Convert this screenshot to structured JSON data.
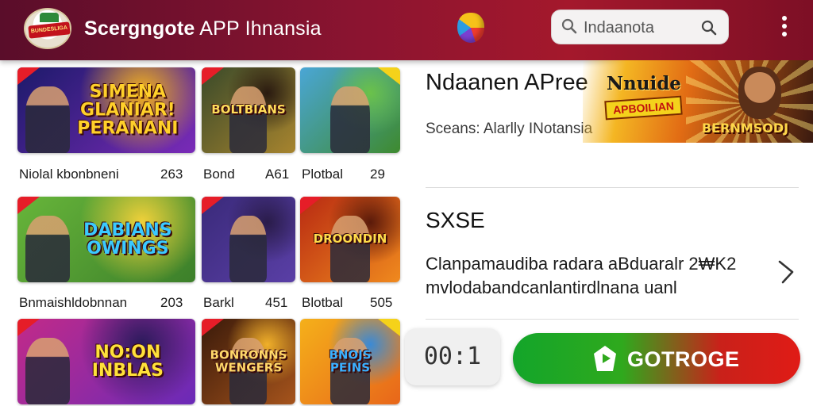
{
  "header": {
    "title_bold": "Scergngote",
    "title_rest": " APP Ihnansia",
    "logo_text": "BUNDESLIGA",
    "search": {
      "value": "Indaanota"
    },
    "menu_icon": "kebab-icon"
  },
  "games": [
    {
      "banner": "SIMENA\nGLANIAR!\nPERANANI",
      "caption": "Niolal kbonbneni",
      "count": "263",
      "colors": [
        "#1c1a6a",
        "#7a2bb8",
        "#f3b21b"
      ],
      "text_color": "#ffd02a"
    },
    {
      "banner": "BOLTBIANS",
      "caption": "Bond",
      "count": "A61",
      "colors": [
        "#3a4a2a",
        "#a7842e",
        "#2a1a10"
      ],
      "text_color": "#ffdd5a"
    },
    {
      "banner": "",
      "caption": "Plotbal",
      "count": "29",
      "colors": [
        "#4aa6d6",
        "#3e8a2e",
        "#6bc24a"
      ],
      "text_color": "#fff"
    },
    {
      "banner": "DABIANS\nOWINGS",
      "caption": "Bnmaishldobnnan",
      "count": "203",
      "colors": [
        "#67b53a",
        "#3c7f2a",
        "#f1d13a"
      ],
      "text_color": "#3ac9ff"
    },
    {
      "banner": "",
      "caption": "Barkl",
      "count": "451",
      "colors": [
        "#3a2a7a",
        "#5a3fa6",
        "#2a1c4a"
      ],
      "text_color": "#fff"
    },
    {
      "banner": "DROONDIN",
      "caption": "Blotbal",
      "count": "505",
      "colors": [
        "#b82a12",
        "#f08a1e",
        "#5a1a0a"
      ],
      "text_color": "#ffdd4a"
    },
    {
      "banner": "NO:ON\nINBLAS",
      "caption": "",
      "count": "",
      "colors": [
        "#c22a88",
        "#6a2ab8",
        "#2a1a5a"
      ],
      "text_color": "#ffe13a"
    },
    {
      "banner": "BONRONNS\nWENGERS",
      "caption": "",
      "count": "",
      "colors": [
        "#3a1a0a",
        "#a6541c",
        "#f0b02a"
      ],
      "text_color": "#ffd86a"
    },
    {
      "banner": "BNOJS\nPEINS",
      "caption": "",
      "count": "",
      "colors": [
        "#f5b01a",
        "#e8661a",
        "#3a8ad6"
      ],
      "text_color": "#3ab0ff"
    }
  ],
  "promo": {
    "heading": "Ndaanen APree",
    "subheading": "Sceans: Alarlly INotansia",
    "banner_top": "Nnuide",
    "banner_mid": "APBOILIAN",
    "banner_bottom": "BERNMSODJ"
  },
  "section": {
    "title": "SXSE",
    "description": "Clanpamaudiba radara aBduaralr 2₩K2 mvlodabandcanlantirdlnana uanl"
  },
  "timer": "00:1",
  "cta": {
    "label": "GOTROGE",
    "icon": "play-shield-icon"
  },
  "accent_colors": {
    "header": "#8c1430",
    "cta_green": "#13a52a",
    "cta_red": "#e01b16"
  }
}
